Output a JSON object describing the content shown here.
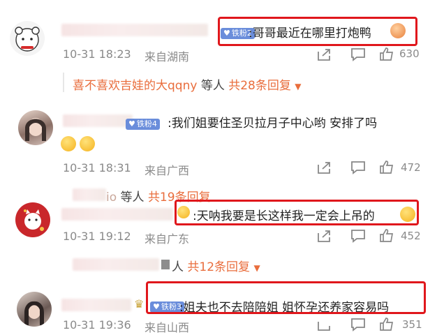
{
  "comments": [
    {
      "fan_badge": "铁粉2",
      "text": ":哥哥最近在哪里打炮鸭",
      "time": "10-31 18:23",
      "location": "来自湖南",
      "like_count": "630"
    },
    {
      "fan_badge": "铁粉4",
      "text": ":我们姐要住圣贝拉月子中心哟 安排了吗",
      "time": "10-31 18:31",
      "location": "来自广西",
      "like_count": "472"
    },
    {
      "fan_badge": "",
      "text": ":天呐我要是长这样我一定会上吊的",
      "time": "10-31 19:12",
      "location": "来自广东",
      "like_count": "452"
    },
    {
      "fan_badge": "铁粉3",
      "text": ":姐夫也不去陪陪姐 姐怀孕还养家容易吗",
      "time": "10-31 19:36",
      "location": "来自山西",
      "like_count": "351"
    }
  ],
  "reply_bars": [
    {
      "users": "喜不喜欢吉娃的大qqny",
      "suffix": "等人",
      "count_text": "共28条回复"
    },
    {
      "users": "io",
      "suffix": "等人",
      "count_text": "共19条回复"
    },
    {
      "users": "",
      "suffix": "人",
      "count_text": "共12条回复"
    }
  ],
  "colors": {
    "accent_orange": "#e96d3c",
    "highlight_red": "#e0171c",
    "fan_badge_blue": "#6a8ddb"
  }
}
